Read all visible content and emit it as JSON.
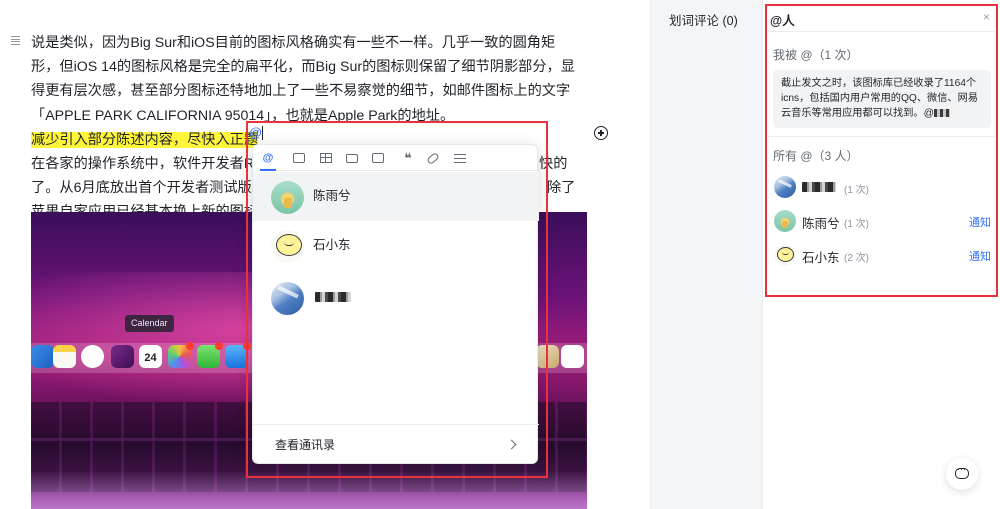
{
  "editor": {
    "lines": [
      "说是类似，因为Big Sur和iOS目前的图标风格确实有一些不一样。几乎一致的圆角矩",
      "形，但iOS 14的图标风格是完全的扁平化，而Big Sur的图标则保留了细节阴影部分，显",
      "得更有层次感，甚至部分图标还特地加上了一些不易察觉的细节，如邮件图标上的文字",
      "「APPLE PARK CALIFORNIA 95014」，也就是Apple Park的地址。"
    ],
    "highlight_text": "减少引入部分陈述内容，尽快入正题",
    "line6_left": "在各家的操作系统中，软件开发者R",
    "line6_right": "快的",
    "line7_left": "了。从6月底放出首个开发者测试版",
    "line7_right": "除了",
    "line8_left": "苹果自家应用已经基本换上新的图标",
    "at_symbol": "@",
    "image": {
      "tooltip": "Calendar",
      "calendar_day": "24"
    }
  },
  "mention_popup": {
    "tools": [
      "at-icon",
      "image-icon",
      "table-icon",
      "folder-icon",
      "code-block-icon",
      "quote-icon",
      "link-icon",
      "more-icon"
    ],
    "at_glyph": "@",
    "quote_glyph": "❝",
    "people": [
      {
        "name": "陈雨兮",
        "avatar": "green"
      },
      {
        "name": "石小东",
        "avatar": "yellow"
      },
      {
        "name": "",
        "avatar": "blue"
      }
    ],
    "footer_label": "查看通讯录"
  },
  "comments_tab": {
    "label": "划词评论 (0)"
  },
  "panel": {
    "search_query": "@人",
    "clear_glyph": "×",
    "mentioned_me_title": "我被 @（1 次）",
    "quote_text": "截止发文之时，该图标库已经收录了1164个icns，包括国内用户常用的QQ、微信、网易云音乐等常用应用都可以找到。@",
    "all_title": "所有 @（3 人）",
    "mentions": [
      {
        "name": "",
        "count": "(1 次)",
        "notify": "",
        "avatar": "blue"
      },
      {
        "name": "陈雨兮",
        "count": "(1 次)",
        "notify": "通知",
        "avatar": "green"
      },
      {
        "name": "石小东",
        "count": "(2 次)",
        "notify": "通知",
        "avatar": "yellow"
      }
    ]
  },
  "colors": {
    "accent": "#3370ff",
    "highlight": "#fff53a",
    "frame": "#e8323c"
  }
}
